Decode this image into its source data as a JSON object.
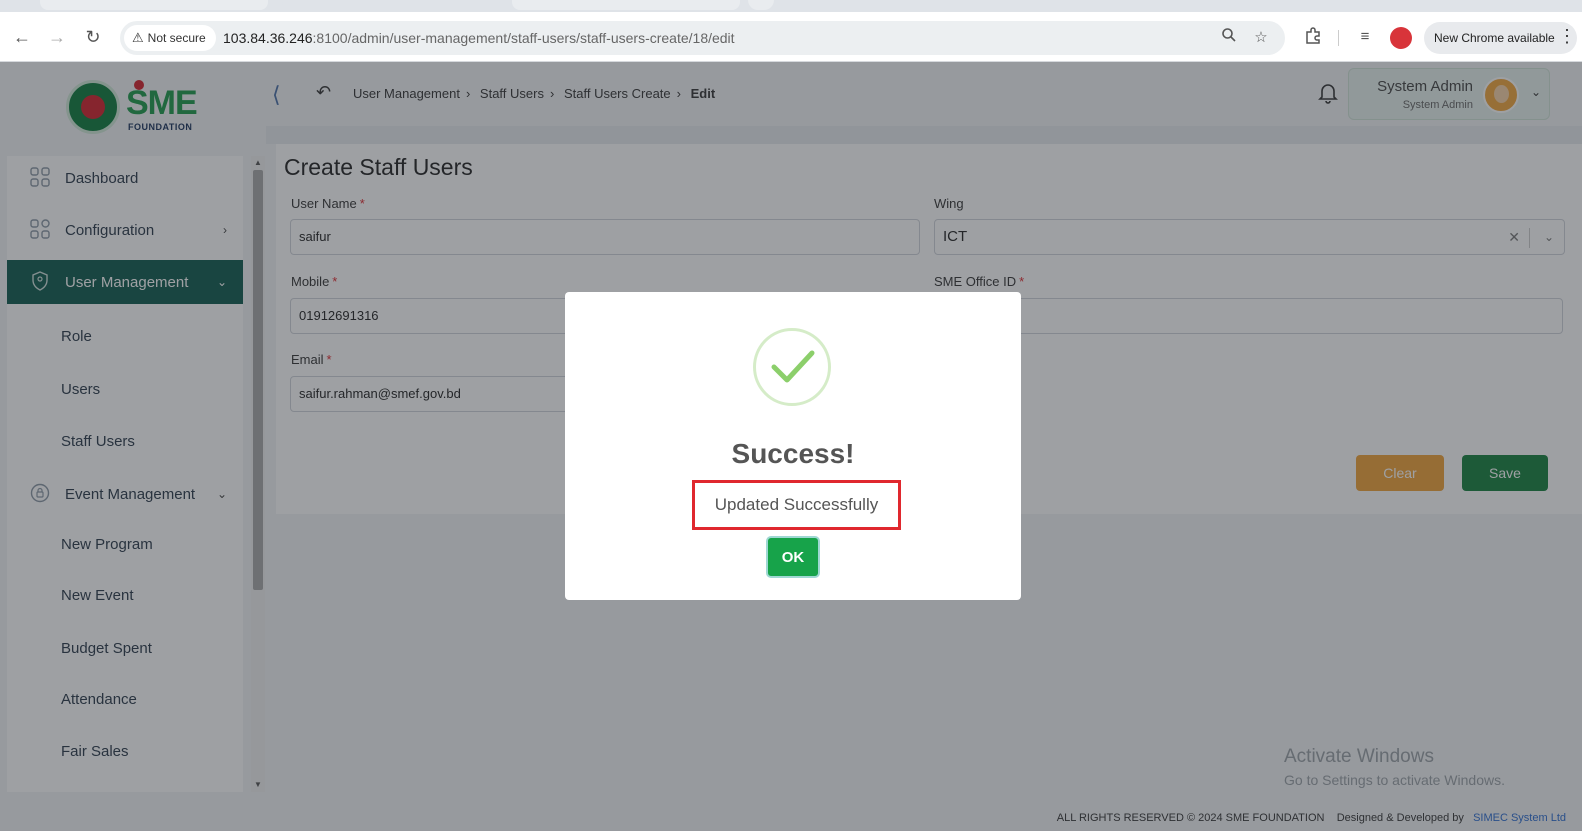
{
  "browser": {
    "not_secure": "Not secure",
    "url_host": "103.84.36.246",
    "url_rest": ":8100/admin/user-management/staff-users/staff-users-create/18/edit",
    "update_label": "New Chrome available"
  },
  "header": {
    "breadcrumb": [
      "User Management",
      "Staff Users",
      "Staff Users Create"
    ],
    "breadcrumb_current": "Edit",
    "user_name": "System Admin",
    "user_role": "System Admin"
  },
  "logo": {
    "text": "SME",
    "sub": "FOUNDATION"
  },
  "sidebar": {
    "items": [
      {
        "label": "Dashboard"
      },
      {
        "label": "Configuration"
      },
      {
        "label": "User Management"
      },
      {
        "label": "Event Management"
      }
    ],
    "sub_user_management": [
      "Role",
      "Users",
      "Staff Users"
    ],
    "sub_event_management": [
      "New Program",
      "New Event",
      "Budget Spent",
      "Attendance",
      "Fair Sales"
    ]
  },
  "form": {
    "title": "Create Staff Users",
    "user_name_label": "User Name",
    "user_name_value": "saifur",
    "wing_label": "Wing",
    "wing_value": "ICT",
    "mobile_label": "Mobile",
    "mobile_value": "01912691316",
    "office_label": "SME Office ID",
    "email_label": "Email",
    "email_value": "saifur.rahman@smef.gov.bd",
    "clear_label": "Clear",
    "save_label": "Save"
  },
  "footer": {
    "rights": "ALL RIGHTS RESERVED © 2024 SME FOUNDATION",
    "designed": "Designed & Developed by",
    "company": "SIMEC System Ltd"
  },
  "watermark": {
    "line1": "Activate Windows",
    "line2": "Go to Settings to activate Windows."
  },
  "modal": {
    "title": "Success!",
    "message": "Updated Successfully",
    "ok_label": "OK"
  },
  "colors": {
    "sidebar_active": "#0e5a4d",
    "save": "#15803d",
    "clear": "#f0a238",
    "ok": "#17a34a",
    "highlight": "#e0282e"
  }
}
